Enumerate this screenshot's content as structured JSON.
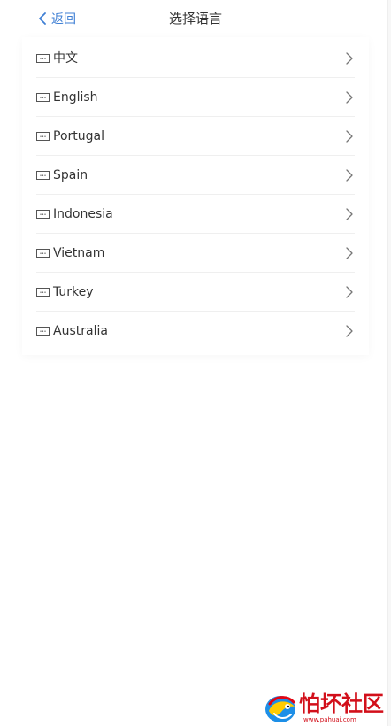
{
  "header": {
    "back_label": "返回",
    "title": "选择语言"
  },
  "languages": [
    {
      "label": "中文",
      "icon": "keyboard-icon"
    },
    {
      "label": "English",
      "icon": "keyboard-icon"
    },
    {
      "label": "Portugal",
      "icon": "keyboard-icon"
    },
    {
      "label": "Spain",
      "icon": "keyboard-icon"
    },
    {
      "label": "Indonesia",
      "icon": "keyboard-icon"
    },
    {
      "label": "Vietnam",
      "icon": "keyboard-icon"
    },
    {
      "label": "Turkey",
      "icon": "keyboard-icon"
    },
    {
      "label": "Australia",
      "icon": "keyboard-icon"
    }
  ],
  "watermark": {
    "name": "怕坏社区",
    "url": "www.pahuai.com"
  },
  "colors": {
    "accent": "#3f7fd4",
    "text": "#333333",
    "separator": "#efefef",
    "watermark": "#d20f1a"
  }
}
